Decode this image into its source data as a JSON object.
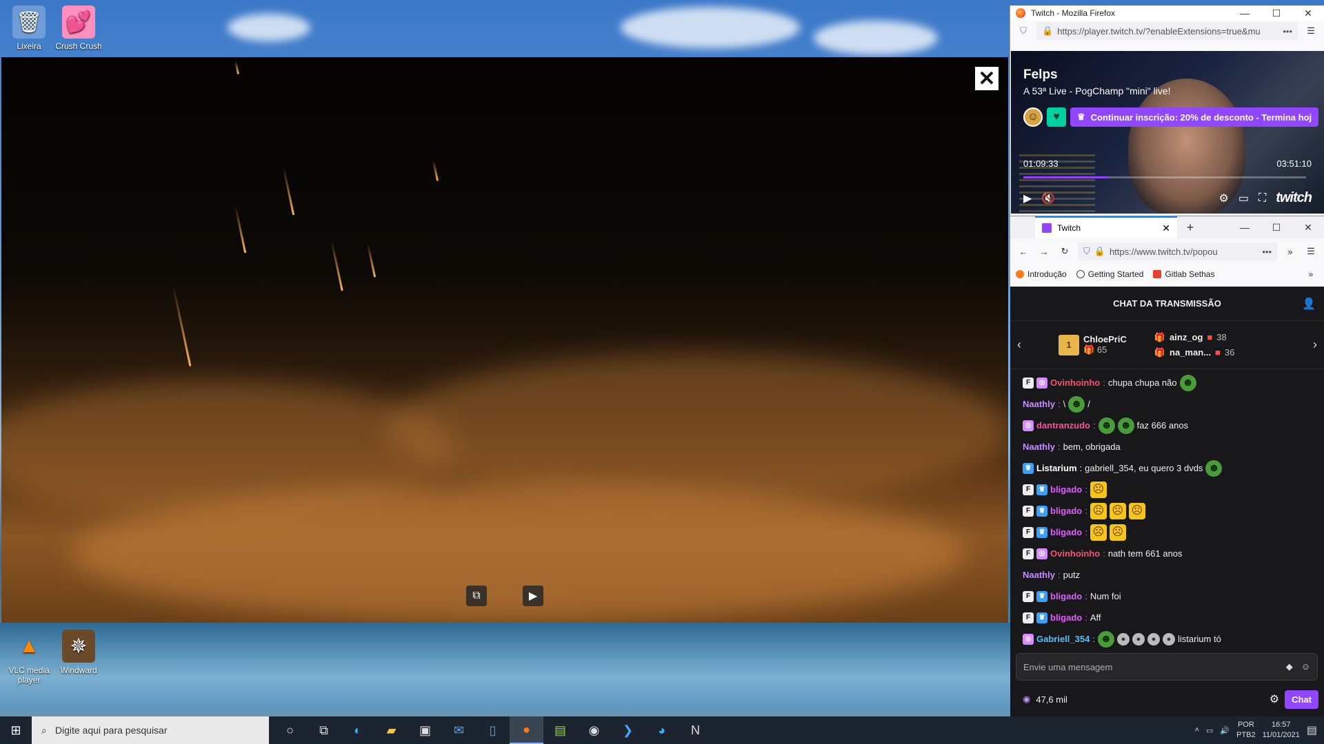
{
  "desktop": {
    "icons_top": [
      {
        "label": "Lixeira",
        "icon": "recycle-bin-icon"
      },
      {
        "label": "Crush Crush",
        "icon": "hearts-icon"
      }
    ],
    "icons_bottom": [
      {
        "label": "VLC media player",
        "icon": "vlc-cone-icon"
      },
      {
        "label": "Windward",
        "icon": "compass-icon"
      }
    ]
  },
  "video_player": {
    "close_label": "✕",
    "buttons": [
      "picture-in-picture-icon",
      "play-icon"
    ]
  },
  "twitch_popup": {
    "window_title": "Twitch - Mozilla Firefox",
    "url": "https://player.twitch.tv/?enableExtensions=true&mu",
    "url_host": "twitch.tv",
    "streamer": "Felps",
    "stream_title": "A 53ª Live - PogChamp \"mini\" live!",
    "sub_offer": "Continuar inscrição: 20% de desconto - Termina hoj",
    "elapsed": "01:09:33",
    "duration": "03:51:10",
    "progress_fraction": 0.3,
    "brand": "twitch"
  },
  "chat_window": {
    "tab_title": "Twitch",
    "url": "https://www.twitch.tv/popou",
    "bookmarks": [
      "Introdução",
      "Getting Started",
      "Gitlab Sethas"
    ],
    "header": "CHAT DA TRANSMISSÃO",
    "leaderboard": {
      "top_gifter": {
        "name": "ChloePriC",
        "count": "65",
        "rank": "1"
      },
      "others": [
        {
          "name": "ainz_og",
          "count": "38"
        },
        {
          "name": "na_man...",
          "count": "36"
        }
      ]
    },
    "messages": [
      {
        "badges": [
          "F",
          "S"
        ],
        "user": "Ovinhoinho",
        "color": "#ff4f6d",
        "text": "chupa chupa não",
        "emotes": [
          "frog"
        ]
      },
      {
        "badges": [],
        "user": "Naathly",
        "color": "#c48cff",
        "text": "\\ ",
        "emotes": [
          "frog"
        ],
        "suffix": " /"
      },
      {
        "badges": [
          "S"
        ],
        "user": "dantranzudo",
        "color": "#ff4fa0",
        "text": "",
        "emotes": [
          "frog",
          "frog"
        ],
        "suffix": " faz 666 anos"
      },
      {
        "badges": [],
        "user": "Naathly",
        "color": "#c48cff",
        "text": "bem, obrigada",
        "emotes": []
      },
      {
        "badges": [
          "P"
        ],
        "user": "Listarium",
        "color": "#ffffff",
        "text": "gabriell_354, eu quero 3 dvds",
        "emotes": [
          "frog"
        ]
      },
      {
        "badges": [
          "F",
          "P"
        ],
        "user": "bligado",
        "color": "#e05cff",
        "text": "",
        "emotes": [
          "face"
        ]
      },
      {
        "badges": [
          "F",
          "P"
        ],
        "user": "bligado",
        "color": "#e05cff",
        "text": "",
        "emotes": [
          "face",
          "face",
          "face"
        ]
      },
      {
        "badges": [
          "F",
          "P"
        ],
        "user": "bligado",
        "color": "#e05cff",
        "text": "",
        "emotes": [
          "face",
          "face"
        ]
      },
      {
        "badges": [
          "F",
          "S"
        ],
        "user": "Ovinhoinho",
        "color": "#ff4f6d",
        "text": "nath tem 661 anos",
        "emotes": []
      },
      {
        "badges": [],
        "user": "Naathly",
        "color": "#c48cff",
        "text": "putz",
        "emotes": []
      },
      {
        "badges": [
          "F",
          "P"
        ],
        "user": "bligado",
        "color": "#e05cff",
        "text": "Num foi",
        "emotes": []
      },
      {
        "badges": [
          "F",
          "P"
        ],
        "user": "bligado",
        "color": "#e05cff",
        "text": "Aff",
        "emotes": []
      },
      {
        "badges": [
          "S"
        ],
        "user": "Gabriell_354",
        "color": "#4fc3ff",
        "text": "",
        "emotes": [
          "frog",
          "orb",
          "orb",
          "orb",
          "orb"
        ],
        "suffix": " listarium tó"
      }
    ],
    "input_placeholder": "Envie uma mensagem",
    "points": "47,6 mil",
    "send_label": "Chat"
  },
  "taskbar": {
    "search_placeholder": "Digite aqui para pesquisar",
    "apps": [
      "cortana-icon",
      "task-view-icon",
      "edge-icon",
      "explorer-icon",
      "store-icon",
      "mail-icon",
      "phone-icon",
      "firefox-icon",
      "notepad-icon",
      "app-icon",
      "terminal-icon",
      "messenger-icon",
      "notion-icon"
    ],
    "lang": "POR",
    "layout": "PTB2",
    "time": "16:57",
    "date": "11/01/2021"
  }
}
